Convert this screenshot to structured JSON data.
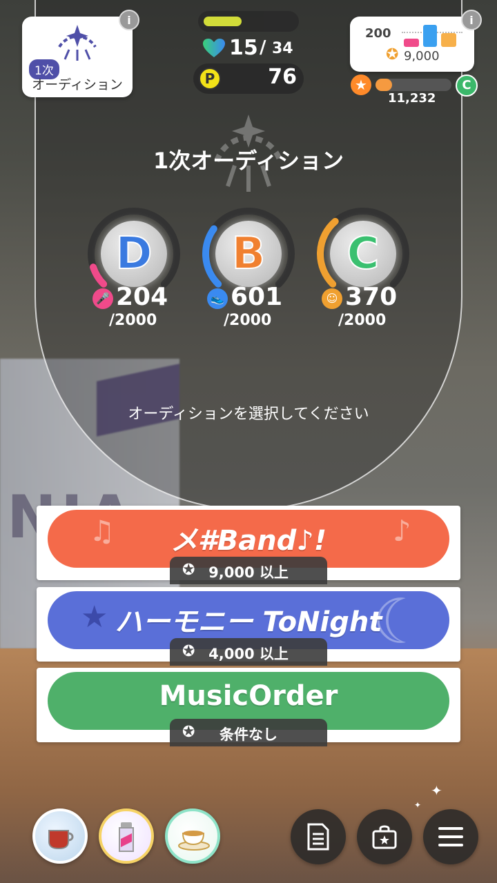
{
  "audition_card": {
    "tag": "1次",
    "name": "オーディション"
  },
  "stamina": {
    "current": "15",
    "slash": "/",
    "max": "34",
    "fill_fraction": 0.42
  },
  "points": {
    "value": "76"
  },
  "fan_card": {
    "label": "200",
    "value": "9,000"
  },
  "rank": {
    "value": "11,232",
    "letter": "C",
    "fill_fraction": 0.22
  },
  "title": "1次オーディション",
  "stats": [
    {
      "letter": "D",
      "value": "204",
      "max": "/2000",
      "icon": "microphone-icon",
      "color": "#f04a8a",
      "gauge_fraction": 0.1
    },
    {
      "letter": "B",
      "value": "601",
      "max": "/2000",
      "icon": "shoe-icon",
      "color": "#3a8af0",
      "gauge_fraction": 0.3
    },
    {
      "letter": "C",
      "value": "370",
      "max": "/2000",
      "icon": "face-icon",
      "color": "#f0a030",
      "gauge_fraction": 0.35
    }
  ],
  "prompt": "オーディションを選択してください",
  "auditions": [
    {
      "label": "メ#Band♪!",
      "requirement": "9,000 以上",
      "color": "#f46a4a"
    },
    {
      "label": "ハーモニー ToNight",
      "requirement": "4,000 以上",
      "color": "#5a6fd8"
    },
    {
      "label": "MusicOrder",
      "requirement": "条件なし",
      "color": "#4fb06a"
    }
  ],
  "bottom": {
    "items": [
      "tea-cup-icon",
      "drink-bottle-icon",
      "teacup-saucer-icon"
    ],
    "menus": [
      "document-icon",
      "shop-bag-icon",
      "menu-icon"
    ]
  }
}
